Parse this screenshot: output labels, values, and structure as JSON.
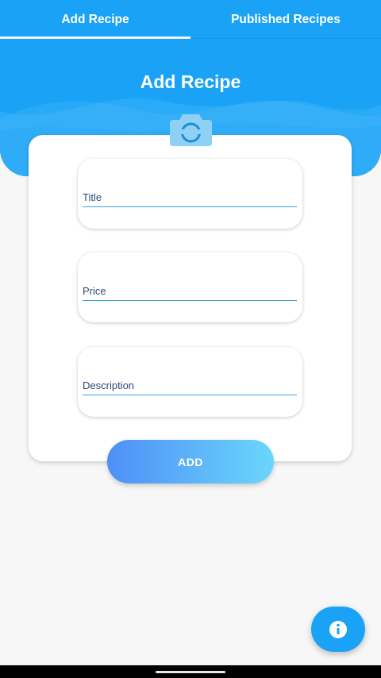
{
  "tabs": [
    {
      "label": "Add Recipe",
      "selected": true
    },
    {
      "label": "Published Recipes",
      "selected": false
    }
  ],
  "header": {
    "title": "Add Recipe"
  },
  "camera": {
    "icon": "camera-icon"
  },
  "form": {
    "title_placeholder": "Title",
    "title_value": "",
    "price_placeholder": "Price",
    "price_value": "",
    "description_placeholder": "Description",
    "description_value": "",
    "add_label": "ADD"
  },
  "fab": {
    "icon": "info-icon"
  },
  "colors": {
    "primary": "#1aa3f6",
    "gradient_start": "#4f8ff7",
    "gradient_end": "#6ad6fb",
    "underline": "#3a9fe0",
    "background": "#f7f7f7"
  }
}
